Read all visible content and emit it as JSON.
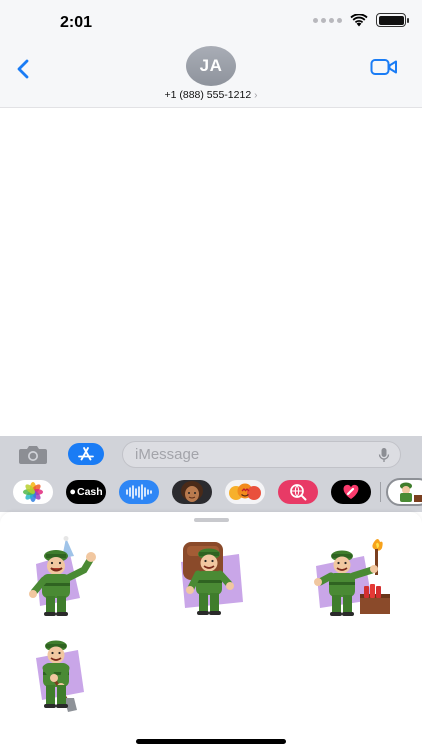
{
  "status_bar": {
    "time": "2:01"
  },
  "header": {
    "avatar_initials": "JA",
    "contact": "+1 (888) 555-1212",
    "contact_chevron": "›"
  },
  "input_bar": {
    "placeholder": "iMessage"
  },
  "app_drawer": {
    "apps": [
      {
        "name": "photos-icon"
      },
      {
        "name": "apple-cash-icon",
        "label": "Cash"
      },
      {
        "name": "audio-message-icon"
      },
      {
        "name": "memoji-icon"
      },
      {
        "name": "memoji-stickers-icon"
      },
      {
        "name": "image-search-icon"
      },
      {
        "name": "digital-touch-icon"
      },
      {
        "name": "army-stickers-app-icon"
      }
    ]
  },
  "stickers": [
    {
      "name": "soldier-waving-party-hat"
    },
    {
      "name": "soldier-with-backpack"
    },
    {
      "name": "soldier-with-torch-and-dynamite"
    },
    {
      "name": "soldier-with-shovel"
    }
  ],
  "colors": {
    "accent": "#1a7cf5",
    "uniform": "#4a8a34",
    "uniform_dark": "#2f6321",
    "skin": "#f1c7a0",
    "header_bg": "#f6f7f9",
    "drawer_bg": "#d1d3d9"
  }
}
